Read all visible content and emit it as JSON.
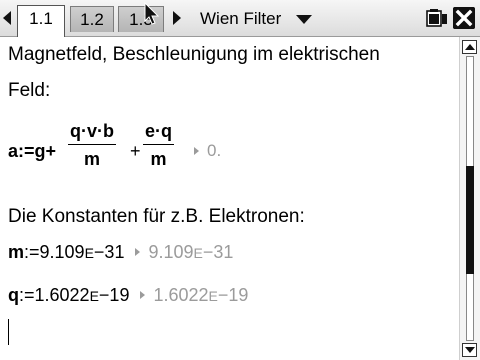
{
  "tabs": [
    {
      "label": "1.1",
      "active": true
    },
    {
      "label": "1.2",
      "active": false
    },
    {
      "label": "1.3",
      "active": false
    }
  ],
  "document": {
    "title": "Wien Filter"
  },
  "icons": {
    "nav_left": "left-triangle-icon",
    "nav_right": "right-triangle-icon",
    "dropdown": "dropdown-triangle-icon",
    "battery": "battery-icon",
    "close": "close-icon",
    "cursor": "mouse-cursor-icon"
  },
  "notes": {
    "line1": "Magnetfeld, Beschleunigung im elektrischen",
    "line2": "Feld:",
    "constants_heading": "Die Konstanten für z.B. Elektronen:"
  },
  "calc": {
    "a": {
      "var": "a",
      "assign": ":=g+",
      "frac1_num": "q·v·b",
      "frac1_den": "m",
      "plus": "+",
      "frac2_num": "e·q",
      "frac2_den": "m",
      "result": "0."
    },
    "m": {
      "var": "m",
      "assign": ":=9.109",
      "exp": "E",
      "assign_tail": "−31",
      "result": "9.109",
      "result_exp": "E",
      "result_tail": "−31"
    },
    "q": {
      "var": "q",
      "assign": ":=1.6022",
      "exp": "E",
      "assign_tail": "−19",
      "result": "1.6022",
      "result_exp": "E",
      "result_tail": "−19"
    }
  },
  "scrollbar": {
    "position": 0.62,
    "visible_fraction": 0.38
  }
}
